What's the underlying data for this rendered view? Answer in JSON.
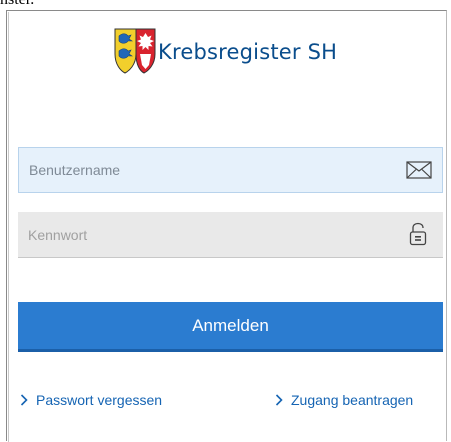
{
  "window": {
    "title_fragment": "nster."
  },
  "header": {
    "app_title": "Krebsregister SH"
  },
  "form": {
    "username": {
      "value": "",
      "placeholder": "Benutzername",
      "icon": "envelope-icon"
    },
    "password": {
      "value": "",
      "placeholder": "Kennwort",
      "icon": "lock-icon"
    },
    "login_label": "Anmelden"
  },
  "links": {
    "forgot_password": "Passwort vergessen",
    "request_access": "Zugang beantragen"
  },
  "colors": {
    "brand_blue": "#0a4d8c",
    "button_blue": "#2b7cd0",
    "link_blue": "#1564b3",
    "username_bg": "#e6f1fb",
    "password_bg": "#e9e9e9"
  }
}
